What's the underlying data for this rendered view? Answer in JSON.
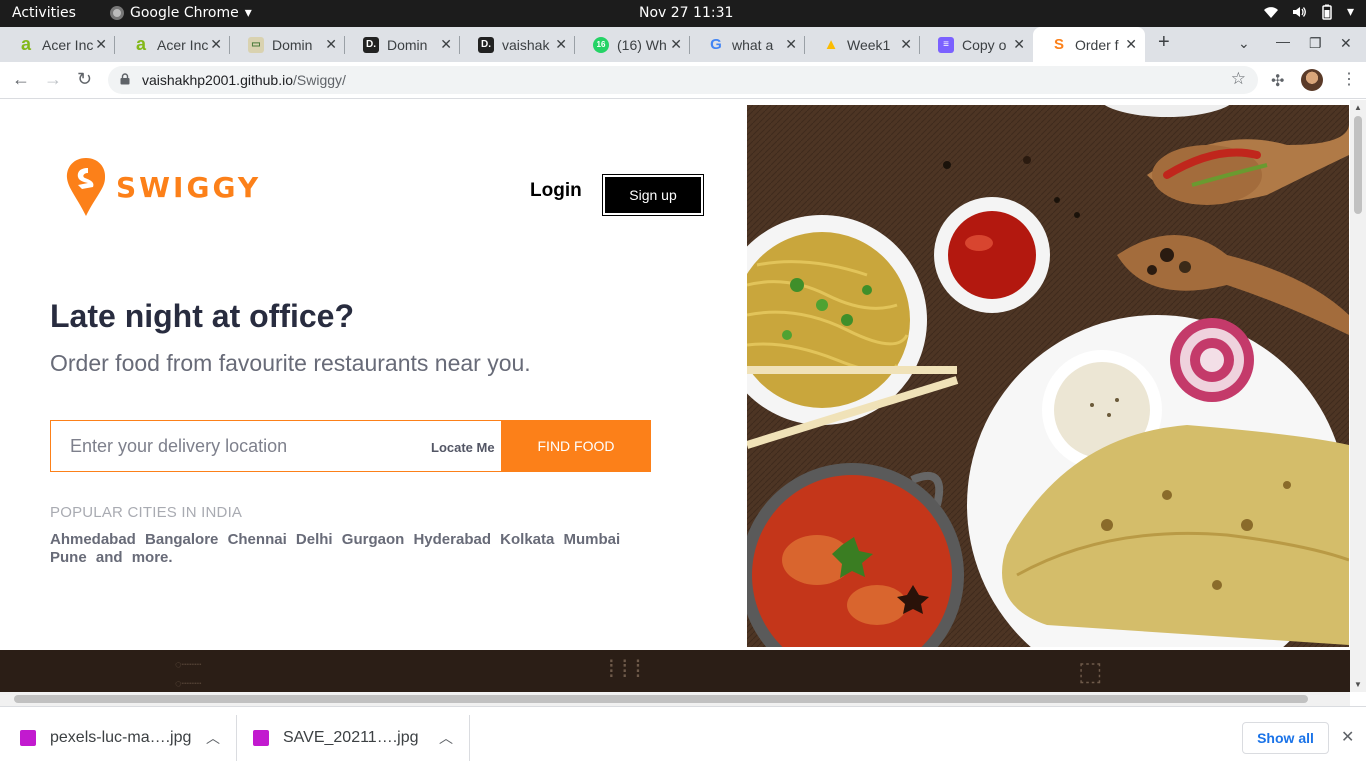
{
  "system": {
    "activities": "Activities",
    "app_name": "Google Chrome",
    "clock": "Nov 27  11:31"
  },
  "tabs": [
    {
      "label": "Acer Inc",
      "favicon_color": "#83b81a",
      "favicon_glyph": "a"
    },
    {
      "label": "Acer Inc",
      "favicon_color": "#83b81a",
      "favicon_glyph": "a"
    },
    {
      "label": "Domin",
      "favicon_color": "#d9d2b0",
      "favicon_glyph": "▭"
    },
    {
      "label": "Domin",
      "favicon_color": "#222222",
      "favicon_glyph": "D."
    },
    {
      "label": "vaishak",
      "favicon_color": "#222222",
      "favicon_glyph": "D."
    },
    {
      "label": "(16) Wh",
      "favicon_color": "#25d366",
      "favicon_glyph": "16"
    },
    {
      "label": "what a",
      "favicon_color": "#ffffff",
      "favicon_glyph": "G"
    },
    {
      "label": "Week1",
      "favicon_color": "#ffffff",
      "favicon_glyph": "▲"
    },
    {
      "label": "Copy o",
      "favicon_color": "#7b61ff",
      "favicon_glyph": "≡"
    },
    {
      "label": "Order f",
      "favicon_color": "#ffffff",
      "favicon_glyph": "S",
      "active": true
    }
  ],
  "address_bar": {
    "host": "vaishakhp2001.github.io",
    "path": "/Swiggy/"
  },
  "header": {
    "brand": "SWIGGY",
    "brand_color": "#fc8019",
    "login": "Login",
    "signup": "Sign up"
  },
  "hero": {
    "title": "Late night at office?",
    "subtitle": "Order food from favourite restaurants near you."
  },
  "search": {
    "placeholder": "Enter your delivery location",
    "locate": "Locate Me",
    "button": "FIND FOOD"
  },
  "cities": {
    "title": "POPULAR CITIES IN INDIA",
    "items": [
      "Ahmedabad",
      "Bangalore",
      "Chennai",
      "Delhi",
      "Gurgaon",
      "Hyderabad",
      "Kolkata",
      "Mumbai",
      "Pune",
      "and",
      "more."
    ]
  },
  "downloads": {
    "items": [
      {
        "name": "pexels-luc-ma….jpg"
      },
      {
        "name": "SAVE_20211….jpg"
      }
    ],
    "show_all": "Show all"
  }
}
